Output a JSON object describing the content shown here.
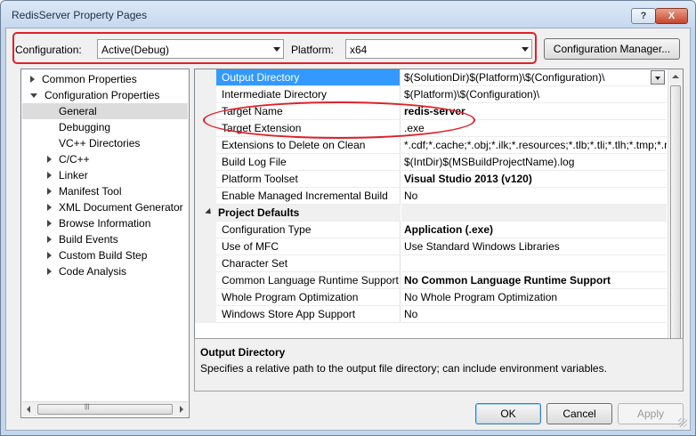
{
  "window": {
    "title": "RedisServer Property Pages",
    "help_glyph": "?",
    "close_glyph": "X"
  },
  "toolbar": {
    "configuration_label": "Configuration:",
    "configuration_value": "Active(Debug)",
    "platform_label": "Platform:",
    "platform_value": "x64",
    "config_manager_label": "Configuration Manager..."
  },
  "tree": {
    "items": [
      {
        "label": "Common Properties",
        "expander": "closed",
        "indent": 0
      },
      {
        "label": "Configuration Properties",
        "expander": "open",
        "indent": 0
      },
      {
        "label": "General",
        "expander": "none",
        "indent": 1,
        "selected": true
      },
      {
        "label": "Debugging",
        "expander": "none",
        "indent": 1
      },
      {
        "label": "VC++ Directories",
        "expander": "none",
        "indent": 1
      },
      {
        "label": "C/C++",
        "expander": "closed",
        "indent": 1
      },
      {
        "label": "Linker",
        "expander": "closed",
        "indent": 1
      },
      {
        "label": "Manifest Tool",
        "expander": "closed",
        "indent": 1
      },
      {
        "label": "XML Document Generator",
        "expander": "closed",
        "indent": 1
      },
      {
        "label": "Browse Information",
        "expander": "closed",
        "indent": 1
      },
      {
        "label": "Build Events",
        "expander": "closed",
        "indent": 1
      },
      {
        "label": "Custom Build Step",
        "expander": "closed",
        "indent": 1
      },
      {
        "label": "Code Analysis",
        "expander": "closed",
        "indent": 1
      }
    ]
  },
  "grid": {
    "rows": [
      {
        "name": "Output Directory",
        "value": "$(SolutionDir)$(Platform)\\$(Configuration)\\",
        "selected": true,
        "bold": false
      },
      {
        "name": "Intermediate Directory",
        "value": "$(Platform)\\$(Configuration)\\",
        "bold": false
      },
      {
        "name": "Target Name",
        "value": "redis-server",
        "bold": true
      },
      {
        "name": "Target Extension",
        "value": ".exe",
        "bold": false
      },
      {
        "name": "Extensions to Delete on Clean",
        "value": "*.cdf;*.cache;*.obj;*.ilk;*.resources;*.tlb;*.tli;*.tlh;*.tmp;*.r",
        "bold": false
      },
      {
        "name": "Build Log File",
        "value": "$(IntDir)$(MSBuildProjectName).log",
        "bold": false
      },
      {
        "name": "Platform Toolset",
        "value": "Visual Studio 2013 (v120)",
        "bold": true
      },
      {
        "name": "Enable Managed Incremental Build",
        "value": "No",
        "bold": false
      },
      {
        "name": "Project Defaults",
        "value": "",
        "category": true
      },
      {
        "name": "Configuration Type",
        "value": "Application (.exe)",
        "bold": true
      },
      {
        "name": "Use of MFC",
        "value": "Use Standard Windows Libraries",
        "bold": false
      },
      {
        "name": "Character Set",
        "value": "",
        "bold": false
      },
      {
        "name": "Common Language Runtime Support",
        "value": "No Common Language Runtime Support",
        "bold": true
      },
      {
        "name": "Whole Program Optimization",
        "value": "No Whole Program Optimization",
        "bold": false
      },
      {
        "name": "Windows Store App Support",
        "value": "No",
        "bold": false
      }
    ]
  },
  "description": {
    "title": "Output Directory",
    "text": "Specifies a relative path to the output file directory; can include environment variables."
  },
  "buttons": {
    "ok": "OK",
    "cancel": "Cancel",
    "apply": "Apply"
  },
  "colors": {
    "annotation": "#e0202a",
    "selection": "#3399ff"
  }
}
